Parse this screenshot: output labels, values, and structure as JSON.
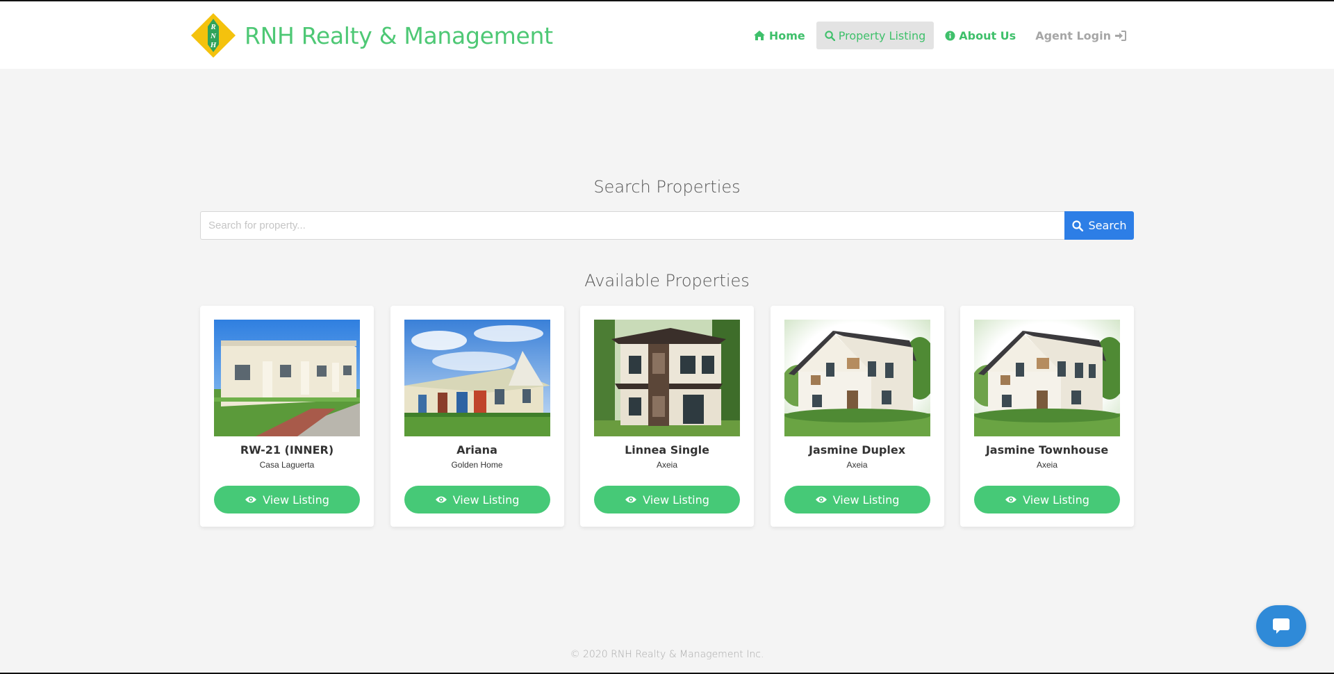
{
  "brand": {
    "name": "RNH Realty & Management",
    "logo_letters": [
      "R",
      "N",
      "H"
    ]
  },
  "nav": {
    "items": [
      {
        "label": "Home",
        "icon": "home-icon"
      },
      {
        "label": "Property Listing",
        "icon": "search-icon"
      },
      {
        "label": "About Us",
        "icon": "info-icon"
      },
      {
        "label": "Agent Login",
        "icon": "sign-in-icon"
      }
    ]
  },
  "search": {
    "title": "Search Properties",
    "placeholder": "Search for property...",
    "value": "",
    "button_label": "Search"
  },
  "listings": {
    "title": "Available Properties",
    "button_label": "View Listing",
    "cards": [
      {
        "name": "RW-21 (INNER)",
        "project": "Casa Laguerta",
        "image": "row-house-photo"
      },
      {
        "name": "Ariana",
        "project": "Golden Home",
        "image": "row-house-photo"
      },
      {
        "name": "Linnea Single",
        "project": "Axeia",
        "image": "two-storey-house-photo"
      },
      {
        "name": "Jasmine Duplex",
        "project": "Axeia",
        "image": "two-storey-house-photo"
      },
      {
        "name": "Jasmine Townhouse",
        "project": "Axeia",
        "image": "two-storey-house-photo"
      }
    ]
  },
  "footer": {
    "text": "© 2020 RNH Realty & Management Inc."
  },
  "colors": {
    "brand_green": "#4ec875",
    "button_green": "#46c977",
    "search_blue": "#2d7ee6",
    "chat_blue": "#2f8ad8",
    "logo_yellow": "#f4c20d"
  },
  "chat": {
    "icon": "chat-bubble-icon"
  }
}
